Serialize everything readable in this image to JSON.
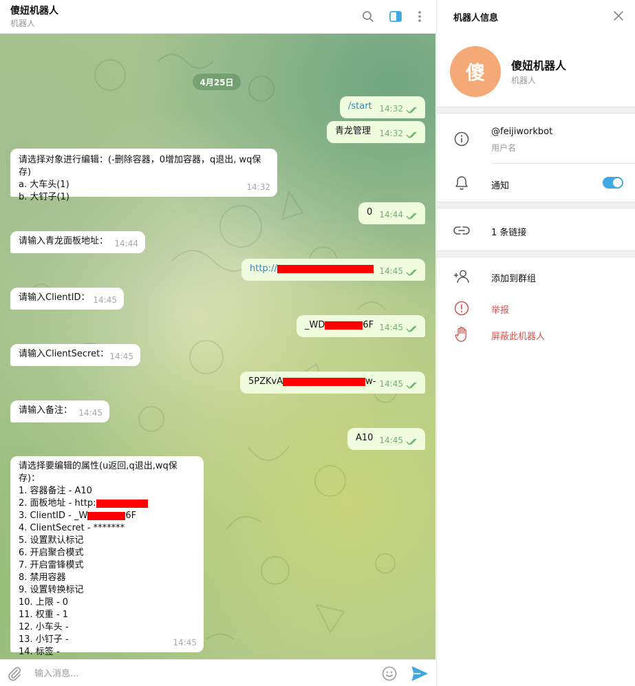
{
  "chat": {
    "title": "傻妞机器人",
    "subtitle": "机器人",
    "date": "4月25日",
    "messages": [
      {
        "dir": "out",
        "text": "/start",
        "time": "14:32"
      },
      {
        "dir": "out",
        "text": "青龙管理",
        "time": "14:32"
      },
      {
        "dir": "in",
        "lines": [
          "请选择对象进行编辑：(-删除容器，0增加容器，q退出, wq保存)",
          "a. 大车头(1)",
          "b. 大钉子(1)"
        ],
        "time": "14:32"
      },
      {
        "dir": "out",
        "text": "0",
        "time": "14:44"
      },
      {
        "dir": "in",
        "text": "请输入青龙面板地址：",
        "time": "14:44"
      },
      {
        "dir": "out",
        "prefix": "http://",
        "time": "14:45"
      },
      {
        "dir": "in",
        "text": "请输入ClientID：",
        "time": "14:45"
      },
      {
        "dir": "out",
        "prefix": "_WD",
        "suffix": "6F",
        "time": "14:45"
      },
      {
        "dir": "in",
        "text": "请输入ClientSecret：",
        "time": "14:45"
      },
      {
        "dir": "out",
        "prefix": "5PZKvA",
        "suffix": "w-",
        "time": "14:45"
      },
      {
        "dir": "in",
        "text": "请输入备注：",
        "time": "14:45"
      },
      {
        "dir": "out",
        "text": "A10",
        "time": "14:45"
      },
      {
        "dir": "in",
        "lines": [
          "请选择要编辑的属性(u返回,q退出,wq保存)：",
          "1. 容器备注 - A10",
          "2. 面板地址 - http:",
          "3. ClientID - _W",
          "4. ClientSecret - *******",
          "5. 设置默认标记",
          "6. 开启聚合模式",
          "7. 开启雷锋模式",
          "8. 禁用容器",
          "9. 设置转换标记",
          "10. 上限 - 0",
          "11. 权重 - 1",
          "12. 小车头 -",
          "13. 小钉子 -",
          "14. 标签 -"
        ],
        "line4_suffix": "6F",
        "time": "14:45"
      }
    ],
    "composer_placeholder": "输入消息..."
  },
  "info": {
    "title": "机器人信息",
    "avatar_char": "傻",
    "name": "傻妞机器人",
    "subtitle": "机器人",
    "username": "@feijiworkbot",
    "username_label": "用户名",
    "notifications_label": "通知",
    "notifications_on": true,
    "links_label": "1 条链接",
    "add_to_group": "添加到群组",
    "report": "举报",
    "block": "屏蔽此机器人"
  },
  "colors": {
    "accent": "#3fa9e0",
    "danger": "#d9534f",
    "avatar": "#f5a977",
    "outgoing_bubble": "#effdde",
    "redaction": "#ff0000"
  }
}
